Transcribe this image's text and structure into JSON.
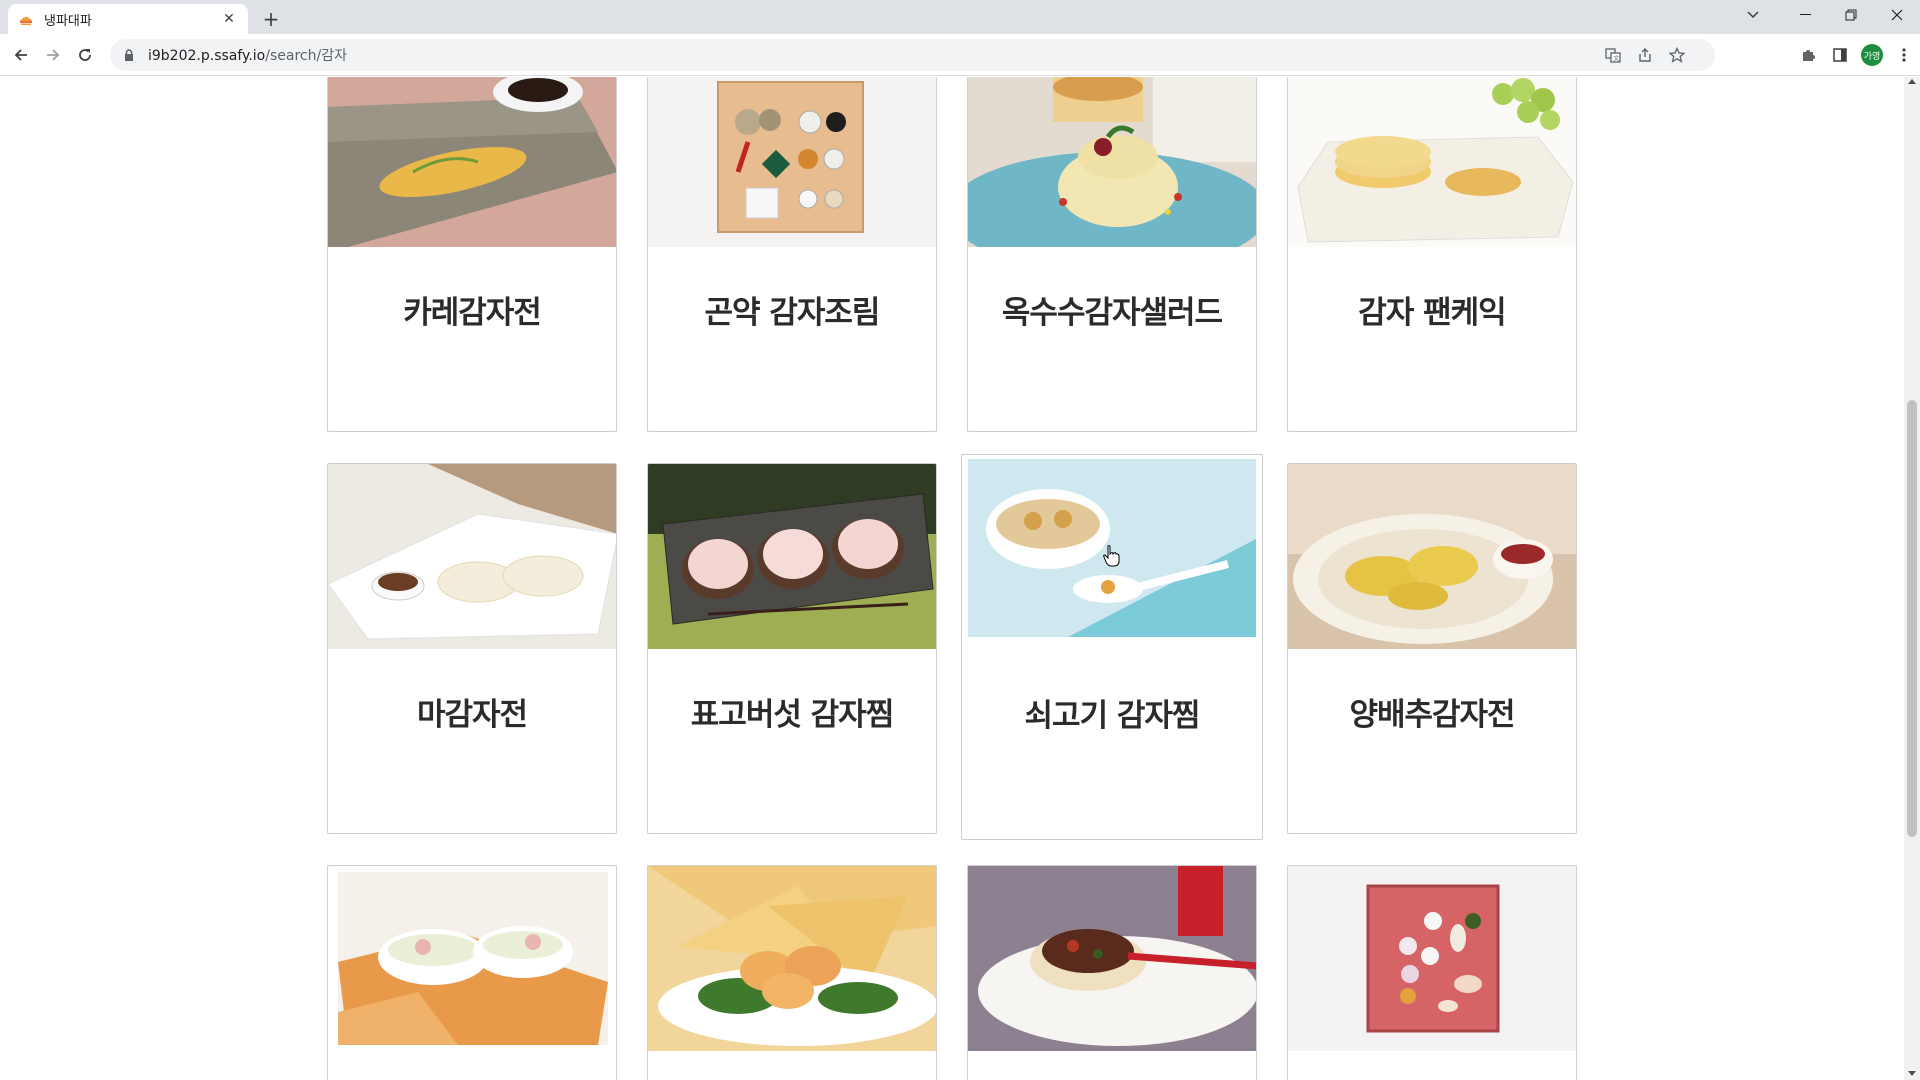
{
  "browser": {
    "tab_title": "냉파대파",
    "url_host": "i9b202.p.ssafy.io",
    "url_path": "/search/감자",
    "profile_initials": "가영"
  },
  "recipes": [
    {
      "name": "카레감자전",
      "image": "curry-potato-pancake"
    },
    {
      "name": "곤약 감자조림",
      "image": "konjac-ingredients-tray"
    },
    {
      "name": "옥수수감자샐러드",
      "image": "corn-potato-salad"
    },
    {
      "name": "감자 팬케익",
      "image": "potato-pancake-grapes"
    },
    {
      "name": "마감자전",
      "image": "yam-potato-pancake"
    },
    {
      "name": "표고버섯 감자찜",
      "image": "shiitake-stuffed"
    },
    {
      "name": "쇠고기 감자찜",
      "image": "beef-potato-soup"
    },
    {
      "name": "양배추감자전",
      "image": "cabbage-potato-pancake"
    },
    {
      "name": "",
      "image": "pickled-radish-bowls"
    },
    {
      "name": "",
      "image": "shrimp-potato-chips"
    },
    {
      "name": "",
      "image": "vegetable-tart"
    },
    {
      "name": "",
      "image": "ingredients-red-tray"
    }
  ]
}
